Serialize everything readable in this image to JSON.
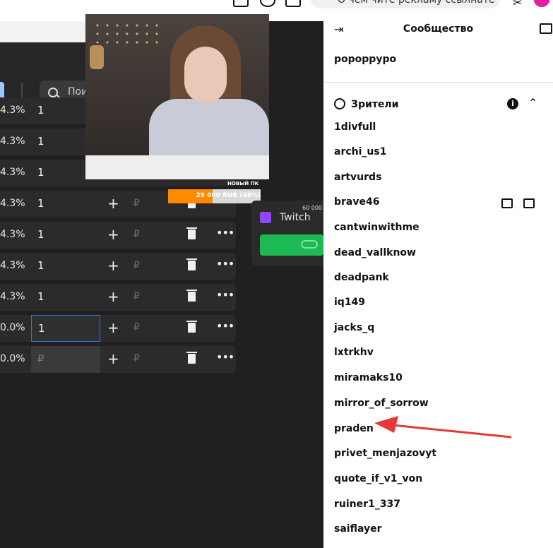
{
  "browser": {
    "banner_text": "О чем чите рекламу ссылнате",
    "brand_color": "#e11ea1"
  },
  "toolbar": {
    "search_placeholder": "Пои",
    "accent": "#9ac6ff"
  },
  "donation_rows": [
    {
      "pct": "4.3%",
      "qty": "1",
      "currency": "₽"
    },
    {
      "pct": "4.3%",
      "qty": "1",
      "currency": "₽"
    },
    {
      "pct": "4.3%",
      "qty": "1",
      "currency": "₽"
    },
    {
      "pct": "4.3%",
      "qty": "1",
      "currency": "₽"
    },
    {
      "pct": "4.3%",
      "qty": "1",
      "currency": "₽"
    },
    {
      "pct": "4.3%",
      "qty": "1",
      "currency": "₽"
    },
    {
      "pct": "4.3%",
      "qty": "1",
      "currency": "₽"
    },
    {
      "pct": "0.0%",
      "qty": "1",
      "currency": "₽"
    },
    {
      "pct": "0.0%",
      "qty": "₽",
      "currency": "₽"
    }
  ],
  "goal": {
    "label": "НОВЫЙ ПК",
    "text": "29 000 RUB (48%)",
    "progress": 0.48,
    "color": "#ff8a00"
  },
  "twitch_card": {
    "platform": "Twitch",
    "amount": "60 000",
    "accent": "#9146ff",
    "button_color": "#1db954"
  },
  "sidebar": {
    "title": "Сообщество",
    "channel": "popoppypo",
    "viewers_title": "Зрители",
    "viewers": [
      "1divfull",
      "archi_us1",
      "artvurds",
      "brave46",
      "cantwinwithme",
      "dead_vallknow",
      "deadpank",
      "iq149",
      "jacks_q",
      "lxtrkhv",
      "miramaks10",
      "mirror_of_sorrow",
      "praden",
      "privet_menjazovyt",
      "quote_if_v1_von",
      "ruiner1_337",
      "saiflayer"
    ]
  },
  "annotation": {
    "color": "#e53935"
  }
}
